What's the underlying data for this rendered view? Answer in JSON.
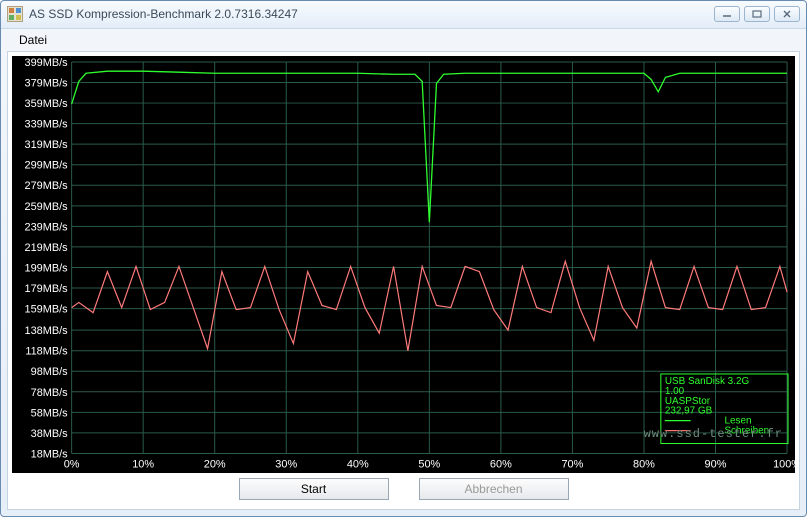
{
  "window": {
    "title": "AS SSD Kompression-Benchmark 2.0.7316.34247"
  },
  "menu": {
    "file": "Datei"
  },
  "buttons": {
    "start": "Start",
    "abort": "Abbrechen"
  },
  "legend": {
    "device": "USB  SanDisk 3.2G",
    "firmware": "1.00",
    "driver": "UASPStor",
    "capacity": "232,97 GB",
    "read": "Lesen",
    "write": "Schreiben"
  },
  "watermark": "www.ssd-tester.fr",
  "chart_data": {
    "type": "line",
    "xlabel": "",
    "ylabel": "",
    "x_unit": "%",
    "y_unit": "MB/s",
    "xlim": [
      0,
      100
    ],
    "ylim": [
      18,
      399
    ],
    "y_ticks": [
      399,
      379,
      359,
      339,
      319,
      299,
      279,
      259,
      239,
      219,
      199,
      179,
      159,
      138,
      118,
      98,
      78,
      58,
      38,
      18
    ],
    "x_ticks": [
      0,
      10,
      20,
      30,
      40,
      50,
      60,
      70,
      80,
      90,
      100
    ],
    "series": [
      {
        "name": "Lesen",
        "color": "#2eff2e",
        "x": [
          0,
          1,
          2,
          5,
          10,
          15,
          20,
          25,
          30,
          35,
          40,
          45,
          48,
          49,
          50,
          51,
          52,
          55,
          60,
          65,
          70,
          75,
          80,
          81,
          82,
          83,
          85,
          90,
          95,
          100
        ],
        "y": [
          358,
          380,
          388,
          390,
          390,
          389,
          388,
          388,
          388,
          388,
          388,
          387,
          387,
          380,
          243,
          378,
          387,
          388,
          388,
          388,
          388,
          388,
          388,
          382,
          370,
          384,
          388,
          388,
          388,
          388
        ]
      },
      {
        "name": "Schreiben",
        "color": "#ff7a7a",
        "x": [
          0,
          1,
          3,
          5,
          7,
          9,
          11,
          13,
          15,
          17,
          19,
          21,
          23,
          25,
          27,
          29,
          31,
          33,
          35,
          37,
          39,
          41,
          43,
          45,
          47,
          49,
          51,
          53,
          55,
          57,
          59,
          61,
          63,
          65,
          67,
          69,
          71,
          73,
          75,
          77,
          79,
          81,
          83,
          85,
          87,
          89,
          91,
          93,
          95,
          97,
          99,
          100
        ],
        "y": [
          160,
          165,
          155,
          195,
          160,
          200,
          158,
          165,
          200,
          160,
          120,
          195,
          158,
          160,
          200,
          158,
          125,
          195,
          162,
          158,
          200,
          160,
          135,
          200,
          118,
          200,
          162,
          160,
          200,
          195,
          158,
          138,
          200,
          160,
          155,
          205,
          160,
          128,
          200,
          160,
          140,
          205,
          160,
          158,
          200,
          160,
          158,
          200,
          158,
          160,
          200,
          175
        ]
      }
    ]
  },
  "y_tick_labels": [
    "399MB/s",
    "379MB/s",
    "359MB/s",
    "339MB/s",
    "319MB/s",
    "299MB/s",
    "279MB/s",
    "259MB/s",
    "239MB/s",
    "219MB/s",
    "199MB/s",
    "179MB/s",
    "159MB/s",
    "138MB/s",
    "118MB/s",
    "98MB/s",
    "78MB/s",
    "58MB/s",
    "38MB/s",
    "18MB/s"
  ],
  "x_tick_labels": [
    "0%",
    "10%",
    "20%",
    "30%",
    "40%",
    "50%",
    "60%",
    "70%",
    "80%",
    "90%",
    "100%"
  ]
}
